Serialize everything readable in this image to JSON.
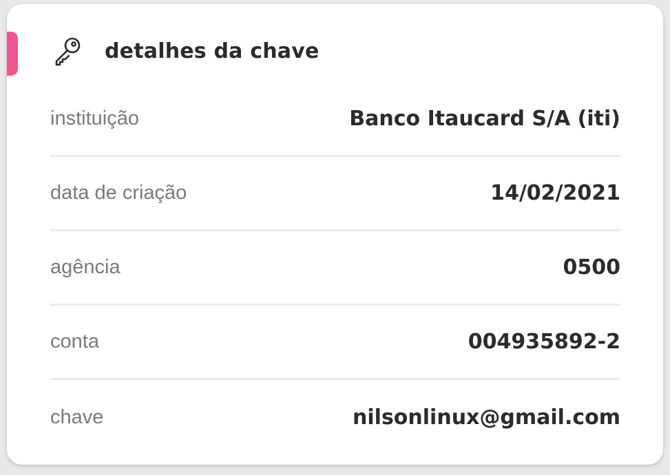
{
  "card": {
    "title": "detalhes da chave",
    "icon": "key-icon",
    "accent_color": "#f0558f"
  },
  "details": [
    {
      "label": "instituição",
      "value": "Banco Itaucard S/A (iti)"
    },
    {
      "label": "data de criação",
      "value": "14/02/2021"
    },
    {
      "label": "agência",
      "value": "0500"
    },
    {
      "label": "conta",
      "value": "004935892-2"
    },
    {
      "label": "chave",
      "value": "nilsonlinux@gmail.com"
    }
  ]
}
